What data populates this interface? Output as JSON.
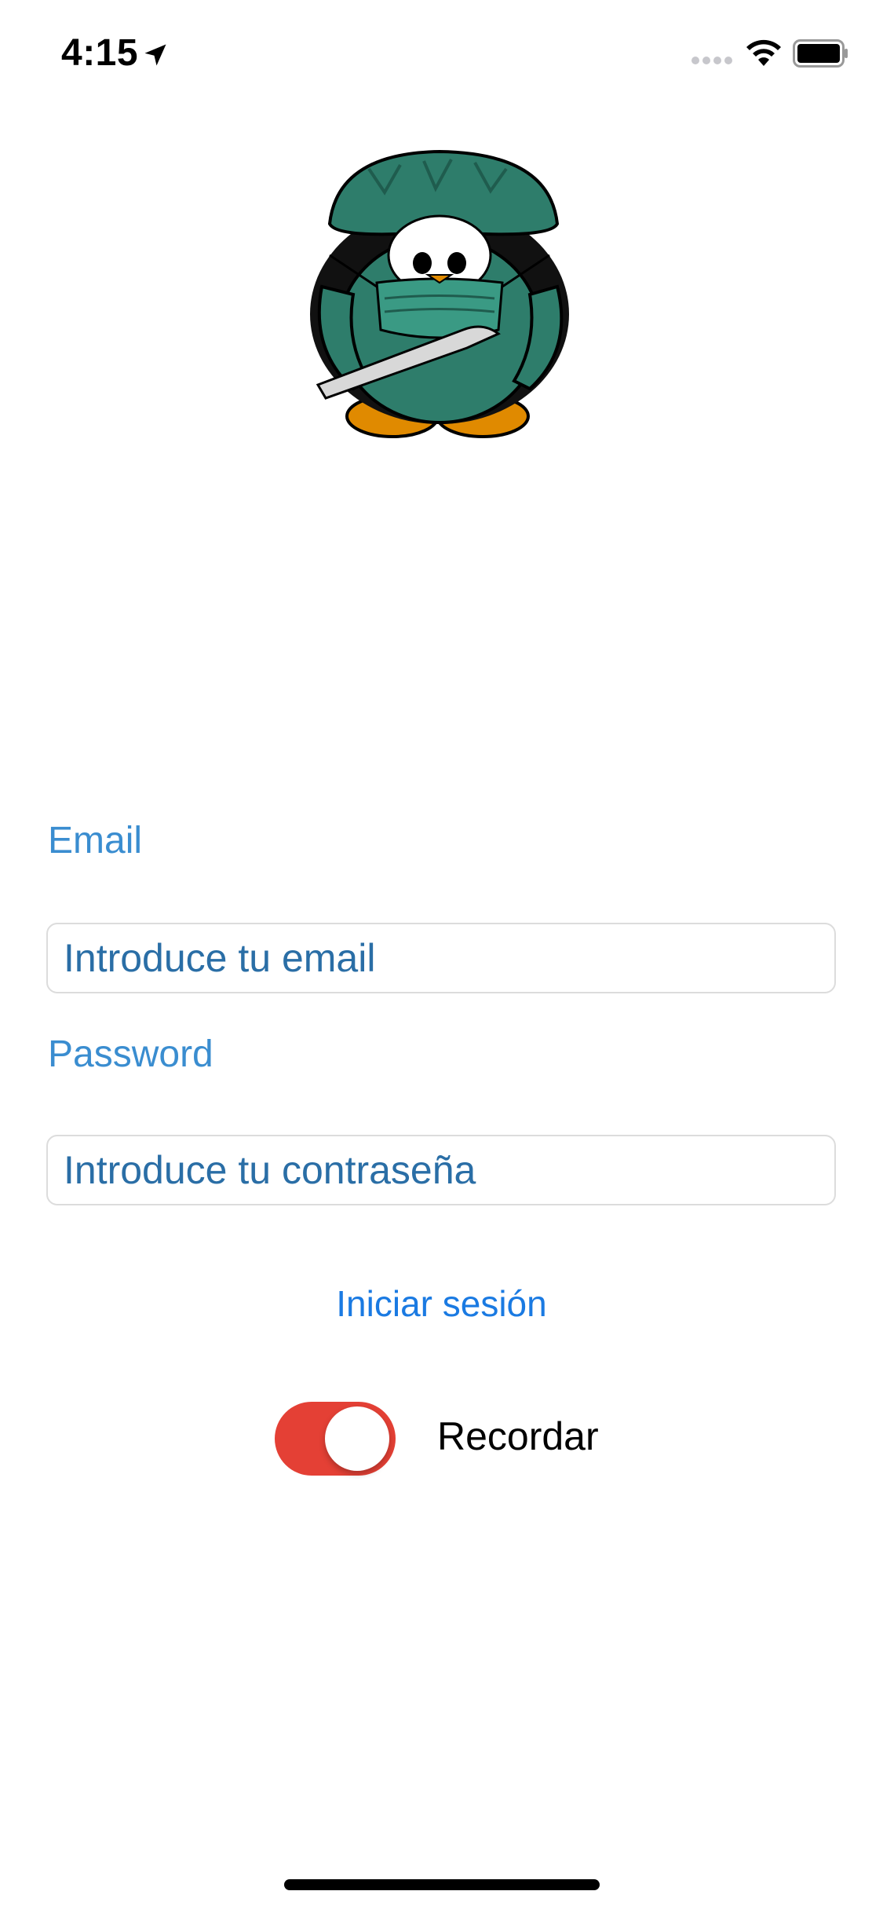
{
  "status_bar": {
    "time": "4:15",
    "icons": [
      "location-arrow-icon",
      "signal-icon",
      "wifi-icon",
      "battery-icon"
    ]
  },
  "mascot": {
    "icon": "surgeon-penguin-mascot"
  },
  "form": {
    "email_label": "Email",
    "email_placeholder": "Introduce tu email",
    "email_value": "",
    "password_label": "Password",
    "password_placeholder": "Introduce tu contraseña",
    "password_value": "",
    "login_label": "Iniciar sesión",
    "remember_label": "Recordar",
    "remember_on": true
  },
  "colors": {
    "accent_label": "#3a8dd0",
    "input_text": "#2a6ea6",
    "link": "#1a7ae2",
    "toggle_on": "#e44035",
    "mascot_scrubs": "#2e7d6b"
  }
}
